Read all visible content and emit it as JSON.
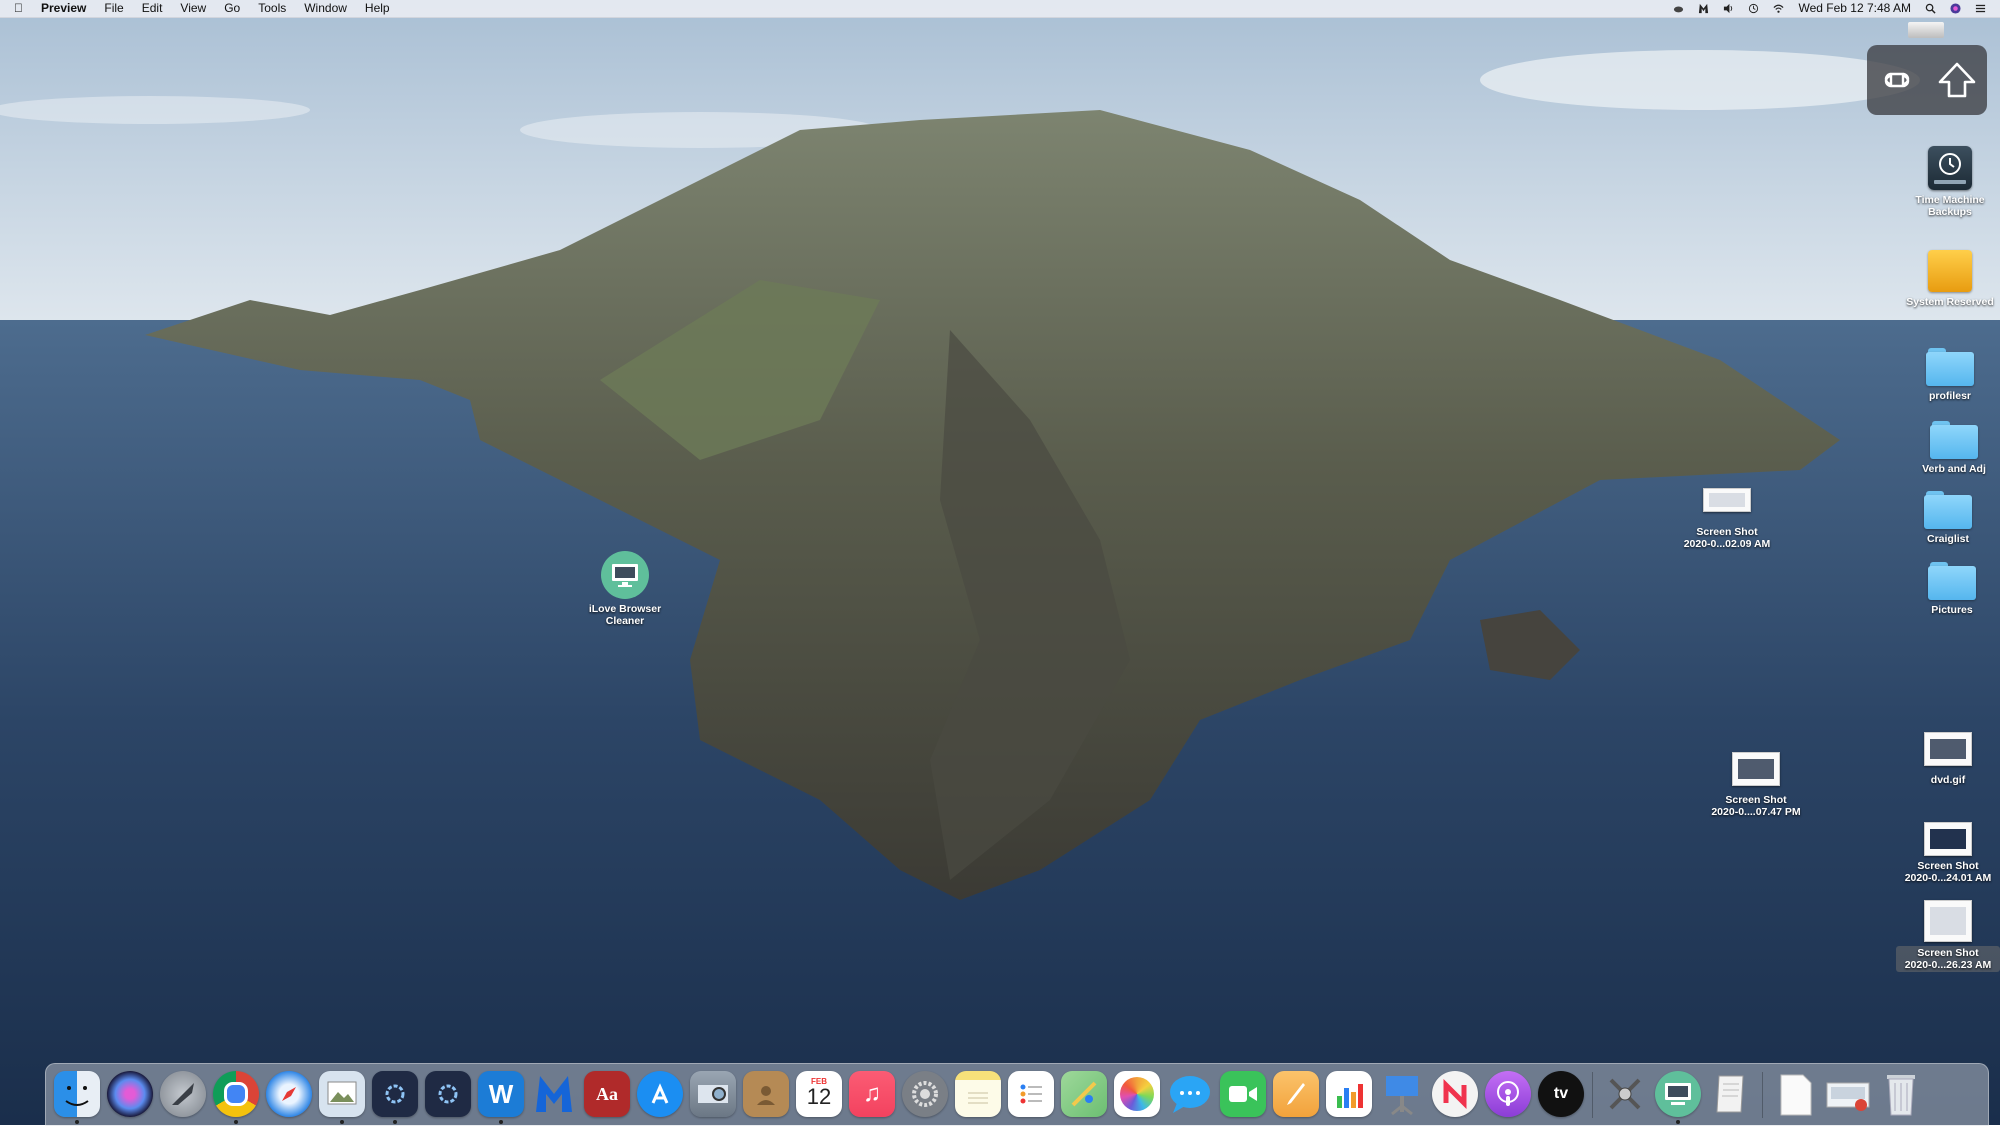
{
  "menubar": {
    "apple_glyph": "",
    "app_name": "Preview",
    "menus": [
      "File",
      "Edit",
      "View",
      "Go",
      "Tools",
      "Window",
      "Help"
    ],
    "clock": "Wed Feb 12  7:48 AM",
    "status_icons": [
      "cloud-icon",
      "malwarebytes-icon",
      "volume-icon",
      "time-machine-icon",
      "wifi-icon",
      "spotlight-icon",
      "siri-icon",
      "notification-center-icon"
    ]
  },
  "desktop": {
    "icons": [
      {
        "label_lines": [
          "Time Machine",
          "Backups"
        ],
        "kind": "time-machine"
      },
      {
        "label_lines": [
          "System Reserved"
        ],
        "kind": "disk"
      },
      {
        "label_lines": [
          "profilesr"
        ],
        "kind": "folder"
      },
      {
        "label_lines": [
          "Verb and Adj"
        ],
        "kind": "folder"
      },
      {
        "label_lines": [
          "Craiglist"
        ],
        "kind": "folder"
      },
      {
        "label_lines": [
          "Pictures"
        ],
        "kind": "folder"
      },
      {
        "label_lines": [
          "Screen Shot",
          "2020-0...02.09 AM"
        ],
        "kind": "screenshot"
      },
      {
        "label_lines": [
          "iLove Browser",
          "Cleaner"
        ],
        "kind": "app"
      },
      {
        "label_lines": [
          "Screen Shot",
          "2020-0....07.47 PM"
        ],
        "kind": "screenshot"
      },
      {
        "label_lines": [
          "dvd.gif"
        ],
        "kind": "image"
      },
      {
        "label_lines": [
          "Screen Shot",
          "2020-0...24.01 AM"
        ],
        "kind": "screenshot"
      },
      {
        "label_lines": [
          "Screen Shot",
          "2020-0...26.23 AM"
        ],
        "kind": "screenshot"
      }
    ]
  },
  "hud": {
    "icons": [
      "command-key-icon",
      "shift-key-icon"
    ]
  },
  "dock": {
    "apps": [
      {
        "name": "finder-icon",
        "color": "#2b8fe8"
      },
      {
        "name": "siri-icon",
        "color": "#2a2a55"
      },
      {
        "name": "launchpad-icon",
        "color": "#8a9099"
      },
      {
        "name": "chrome-icon",
        "color": "#ffffff"
      },
      {
        "name": "safari-icon",
        "color": "#2f86e6"
      },
      {
        "name": "preview-icon",
        "color": "#d7e3ef"
      },
      {
        "name": "app-gear-dark-icon",
        "color": "#1f2a44"
      },
      {
        "name": "app-gear-dark-2-icon",
        "color": "#1f2a44"
      },
      {
        "name": "word-icon",
        "color": "#1c7cd6"
      },
      {
        "name": "malwarebytes-icon",
        "color": "#1565d8"
      },
      {
        "name": "dictionary-icon",
        "color": "#b02a2a"
      },
      {
        "name": "app-store-icon",
        "color": "#1b8ef2"
      },
      {
        "name": "image-capture-icon",
        "color": "#7d8a98"
      },
      {
        "name": "contacts-icon",
        "color": "#b58a55"
      },
      {
        "name": "calendar-icon",
        "color": "#ffffff"
      },
      {
        "name": "music-icon",
        "color": "#f3425f"
      },
      {
        "name": "system-preferences-icon",
        "color": "#7a7f86"
      },
      {
        "name": "notes-icon",
        "color": "#f7e17a"
      },
      {
        "name": "reminders-icon",
        "color": "#ffffff"
      },
      {
        "name": "maps-icon",
        "color": "#6cbf72"
      },
      {
        "name": "photos-icon",
        "color": "#ffffff"
      },
      {
        "name": "messages-icon",
        "color": "#2aa5f5"
      },
      {
        "name": "facetime-icon",
        "color": "#3ac35a"
      },
      {
        "name": "pages-icon",
        "color": "#f2a23b"
      },
      {
        "name": "numbers-icon",
        "color": "#3bbd4f"
      },
      {
        "name": "keynote-icon",
        "color": "#3f8ae6"
      },
      {
        "name": "news-icon",
        "color": "#f3f3f3"
      },
      {
        "name": "podcasts-icon",
        "color": "#9b4be0"
      },
      {
        "name": "apple-tv-icon",
        "color": "#111111"
      },
      {
        "name": "utilities-icon",
        "color": "#cfd3d8"
      },
      {
        "name": "ilove-browser-cleaner-icon",
        "color": "#5fbf9b"
      },
      {
        "name": "textedit-icon",
        "color": "#f2f2f2"
      },
      {
        "name": "documents-folder-icon",
        "color": "#f4f4f4"
      },
      {
        "name": "downloads-stack-icon",
        "color": "#e9edf2"
      },
      {
        "name": "trash-icon",
        "color": "#dfe3e8"
      }
    ],
    "calendar_month": "FEB",
    "calendar_day": "12",
    "tv_label": "tv"
  }
}
